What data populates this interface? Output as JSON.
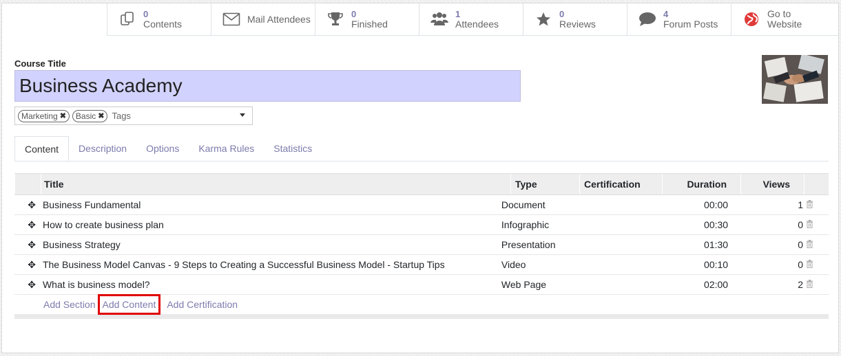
{
  "smart_buttons": [
    {
      "icon": "files-icon",
      "count": "0",
      "label": "Contents"
    },
    {
      "icon": "envelope-icon",
      "count": "",
      "label": "Mail Attendees"
    },
    {
      "icon": "trophy-icon",
      "count": "0",
      "label": "Finished"
    },
    {
      "icon": "users-icon",
      "count": "1",
      "label": "Attendees"
    },
    {
      "icon": "star-icon",
      "count": "0",
      "label": "Reviews"
    },
    {
      "icon": "comment-icon",
      "count": "4",
      "label": "Forum Posts"
    },
    {
      "icon": "globe-icon",
      "count": "Go to",
      "label": "Website"
    }
  ],
  "form": {
    "course_title_label": "Course Title",
    "course_title": "Business Academy",
    "tags": [
      "Marketing",
      "Basic"
    ],
    "tags_placeholder": "Tags"
  },
  "tabs": [
    "Content",
    "Description",
    "Options",
    "Karma Rules",
    "Statistics"
  ],
  "table": {
    "headers": {
      "title": "Title",
      "type": "Type",
      "certification": "Certification",
      "duration": "Duration",
      "views": "Views"
    },
    "rows": [
      {
        "title": "Business Fundamental",
        "type": "Document",
        "duration": "00:00",
        "views": "1"
      },
      {
        "title": "How to create business plan",
        "type": "Infographic",
        "duration": "00:30",
        "views": "0"
      },
      {
        "title": "Business Strategy",
        "type": "Presentation",
        "duration": "01:30",
        "views": "0"
      },
      {
        "title": "The Business Model Canvas - 9 Steps to Creating a Successful Business Model - Startup Tips",
        "type": "Video",
        "duration": "00:10",
        "views": "0"
      },
      {
        "title": "What is business model?",
        "type": "Web Page",
        "duration": "02:00",
        "views": "2"
      }
    ],
    "footer_links": {
      "add_section": "Add Section",
      "add_content": "Add Content",
      "add_certification": "Add Certification"
    }
  },
  "colors": {
    "accent": "#7c7bad",
    "title_bg": "#d2d2ff",
    "highlight": "#e00000"
  }
}
